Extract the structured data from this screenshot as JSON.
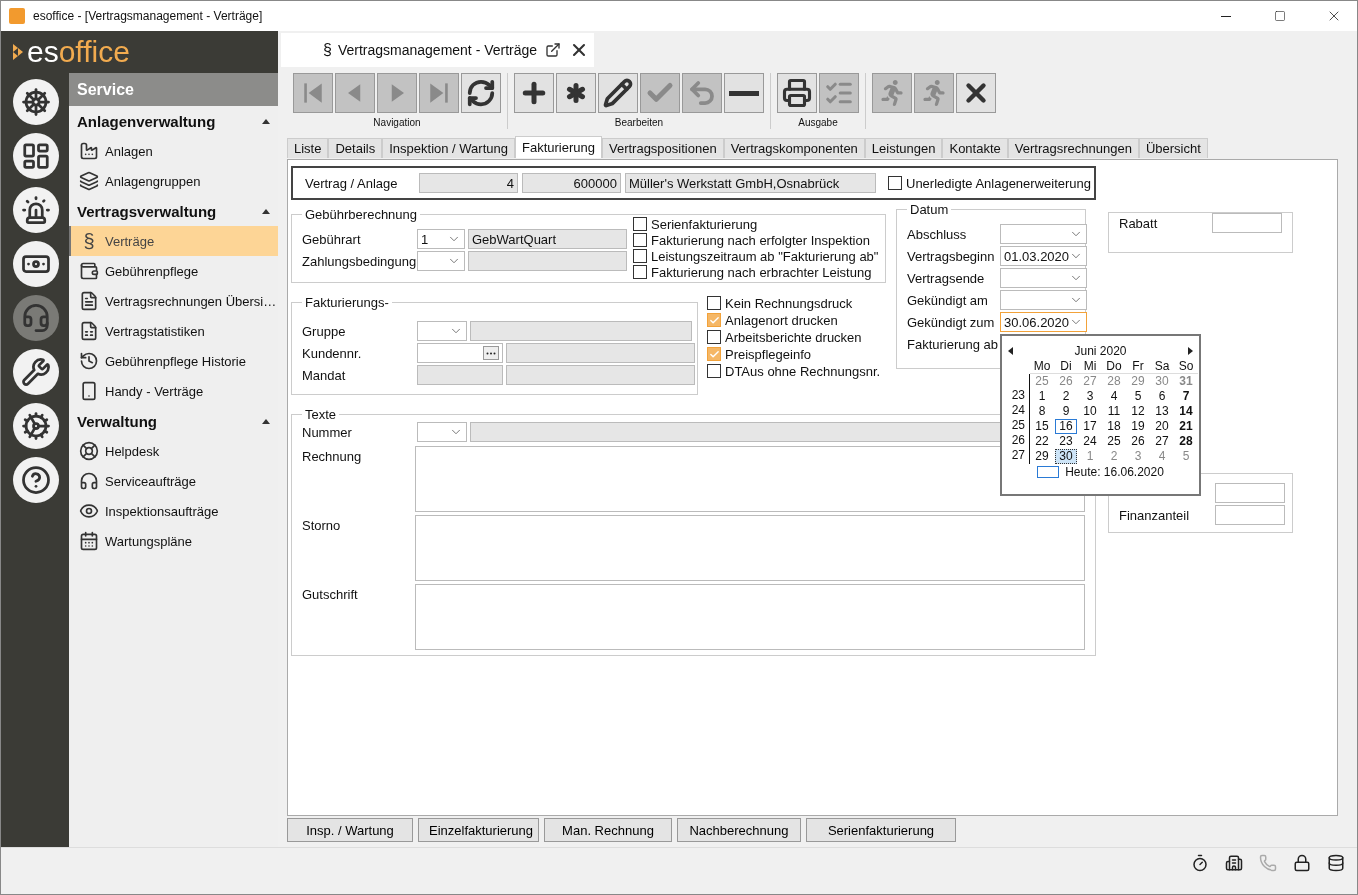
{
  "window": {
    "title": "esoffice - [Vertragsmanagement - Verträge]"
  },
  "logo": {
    "text_start": "es",
    "text_end": "office"
  },
  "modules": [
    {
      "kind": "helm",
      "selected": false
    },
    {
      "kind": "plan",
      "selected": false
    },
    {
      "kind": "alarm",
      "selected": false
    },
    {
      "kind": "money",
      "selected": false
    },
    {
      "kind": "headset",
      "selected": true
    },
    {
      "kind": "tools",
      "selected": false
    },
    {
      "kind": "gears",
      "selected": false
    },
    {
      "kind": "help",
      "selected": false
    }
  ],
  "nav": {
    "title": "Service",
    "sections": [
      {
        "title": "Anlagenverwaltung",
        "expanded": true,
        "items": [
          {
            "label": "Anlagen",
            "selected": false
          },
          {
            "label": "Anlagengruppen",
            "selected": false
          }
        ]
      },
      {
        "title": "Vertragsverwaltung",
        "expanded": true,
        "items": [
          {
            "label": "Verträge",
            "glyph": "§",
            "selected": true
          },
          {
            "label": "Gebührenpflege",
            "selected": false
          },
          {
            "label": "Vertragsrechnungen Übersi…",
            "selected": false
          },
          {
            "label": "Vertragstatistiken",
            "selected": false
          },
          {
            "label": "Gebührenpflege Historie",
            "selected": false
          },
          {
            "label": "Handy - Verträge",
            "selected": false
          }
        ]
      },
      {
        "title": "Verwaltung",
        "expanded": true,
        "items": [
          {
            "label": "Helpdesk",
            "selected": false
          },
          {
            "label": "Serviceaufträge",
            "selected": false
          },
          {
            "label": "Inspektionsaufträge",
            "selected": false
          },
          {
            "label": "Wartungspläne",
            "selected": false
          }
        ]
      }
    ]
  },
  "document_tab": {
    "glyph": "§",
    "title": "Vertragsmanagement - Verträge"
  },
  "toolbar": [
    {
      "label": "Navigation",
      "buttons": [
        {
          "kind": "first",
          "disabled": true
        },
        {
          "kind": "prev",
          "disabled": true
        },
        {
          "kind": "next",
          "disabled": true
        },
        {
          "kind": "last",
          "disabled": true
        },
        {
          "kind": "refresh",
          "disabled": false
        }
      ]
    },
    {
      "label": "Bearbeiten",
      "buttons": [
        {
          "kind": "plus",
          "disabled": false
        },
        {
          "kind": "asterisk",
          "disabled": false
        },
        {
          "kind": "pencil",
          "disabled": false
        },
        {
          "kind": "check",
          "disabled": true
        },
        {
          "kind": "undo",
          "disabled": true
        },
        {
          "kind": "minus",
          "disabled": false
        }
      ]
    },
    {
      "label": "Ausgabe",
      "buttons": [
        {
          "kind": "print",
          "disabled": false
        },
        {
          "kind": "export",
          "disabled": true
        }
      ]
    },
    {
      "buttons": [
        {
          "kind": "run",
          "disabled": true
        },
        {
          "kind": "run",
          "disabled": true
        },
        {
          "kind": "close",
          "disabled": false
        }
      ]
    }
  ],
  "tabs": [
    {
      "label": "Liste",
      "selected": false
    },
    {
      "label": "Details",
      "selected": false
    },
    {
      "label": "Inspektion / Wartung",
      "selected": false
    },
    {
      "label": "Fakturierung",
      "selected": true
    },
    {
      "label": "Vertragspositionen",
      "selected": false
    },
    {
      "label": "Vertragskomponenten",
      "selected": false
    },
    {
      "label": "Leistungen",
      "selected": false
    },
    {
      "label": "Kontakte",
      "selected": false
    },
    {
      "label": "Vertragsrechnungen",
      "selected": false
    },
    {
      "label": "Übersicht",
      "selected": false
    }
  ],
  "contract": {
    "label": "Vertrag / Anlage",
    "number": "4",
    "object": "600000",
    "customer": "Müller's Werkstatt GmbH,Osnabrück",
    "open_extension": {
      "label": "Unerledigte Anlagenerweiterung",
      "checked": false
    }
  },
  "fee": {
    "title": "Gebührberechnung",
    "rows": [
      {
        "label": "Gebührart",
        "code": "1",
        "text": "GebWartQuart"
      },
      {
        "label": "Zahlungsbedingung"
      }
    ],
    "options": [
      {
        "label": "Serienfakturierung",
        "checked": false
      },
      {
        "label": "Fakturierung nach erfolgter Inspektion",
        "checked": false
      },
      {
        "label": "Leistungszeitraum ab \"Fakturierung ab\"",
        "checked": false
      },
      {
        "label": "Fakturierung nach erbrachter Leistung",
        "checked": false
      }
    ]
  },
  "billing": {
    "title": "Fakturierungs-",
    "rows": [
      {
        "label": "Gruppe",
        "kind": "combo"
      },
      {
        "label": "Kundennr.",
        "kind": "lookup"
      },
      {
        "label": "Mandat",
        "kind": "readonly"
      }
    ]
  },
  "print_options": [
    {
      "label": "Kein Rechnungsdruck",
      "checked": false
    },
    {
      "label": "Anlagenort drucken",
      "checked": true
    },
    {
      "label": "Arbeitsberichte drucken",
      "checked": false
    },
    {
      "label": "Preispflegeinfo",
      "checked": true
    },
    {
      "label": "DTAus ohne Rechnungsnr.",
      "checked": false
    }
  ],
  "dates": {
    "title": "Datum",
    "rows": [
      {
        "kind": "date",
        "label": "Abschluss",
        "focused": false
      },
      {
        "kind": "date",
        "label": "Vertragsbeginn",
        "value": "01.03.2020",
        "focused": false
      },
      {
        "kind": "date",
        "label": "Vertragsende",
        "focused": false
      },
      {
        "kind": "date",
        "label": "Gekündigt am",
        "focused": false
      },
      {
        "kind": "date",
        "label": "Gekündigt zum",
        "value": "30.06.2020",
        "focused": true
      },
      {
        "kind": "label",
        "label": "Fakturierung ab"
      }
    ]
  },
  "texts": {
    "title": "Texte",
    "number_label": "Nummer",
    "areas": [
      {
        "label": "Rechnung"
      },
      {
        "label": "Storno"
      },
      {
        "label": "Gutschrift"
      }
    ]
  },
  "discount": {
    "label": "Rabatt"
  },
  "shares": {
    "label": "Finanzanteil"
  },
  "calendar": {
    "month": "Juni 2020",
    "weekdays": [
      "Mo",
      "Di",
      "Mi",
      "Do",
      "Fr",
      "Sa",
      "So"
    ],
    "today_label": "Heute: 16.06.2020",
    "weeks": [
      {
        "days": [
          {
            "day": "25",
            "other_month": true,
            "bold": false,
            "today": false,
            "selected": false
          },
          {
            "day": "26",
            "other_month": true,
            "bold": false,
            "today": false,
            "selected": false
          },
          {
            "day": "27",
            "other_month": true,
            "bold": false,
            "today": false,
            "selected": false
          },
          {
            "day": "28",
            "other_month": true,
            "bold": false,
            "today": false,
            "selected": false
          },
          {
            "day": "29",
            "other_month": true,
            "bold": false,
            "today": false,
            "selected": false
          },
          {
            "day": "30",
            "other_month": true,
            "bold": false,
            "today": false,
            "selected": false
          },
          {
            "day": "31",
            "other_month": true,
            "bold": true,
            "today": false,
            "selected": false
          }
        ]
      },
      {
        "week": "23",
        "days": [
          {
            "day": "1",
            "other_month": false,
            "bold": false,
            "today": false,
            "selected": false
          },
          {
            "day": "2",
            "other_month": false,
            "bold": false,
            "today": false,
            "selected": false
          },
          {
            "day": "3",
            "other_month": false,
            "bold": false,
            "today": false,
            "selected": false
          },
          {
            "day": "4",
            "other_month": false,
            "bold": false,
            "today": false,
            "selected": false
          },
          {
            "day": "5",
            "other_month": false,
            "bold": false,
            "today": false,
            "selected": false
          },
          {
            "day": "6",
            "other_month": false,
            "bold": false,
            "today": false,
            "selected": false
          },
          {
            "day": "7",
            "other_month": false,
            "bold": true,
            "today": false,
            "selected": false
          }
        ]
      },
      {
        "week": "24",
        "days": [
          {
            "day": "8",
            "other_month": false,
            "bold": false,
            "today": false,
            "selected": false
          },
          {
            "day": "9",
            "other_month": false,
            "bold": false,
            "today": false,
            "selected": false
          },
          {
            "day": "10",
            "other_month": false,
            "bold": false,
            "today": false,
            "selected": false
          },
          {
            "day": "11",
            "other_month": false,
            "bold": false,
            "today": false,
            "selected": false
          },
          {
            "day": "12",
            "other_month": false,
            "bold": false,
            "today": false,
            "selected": false
          },
          {
            "day": "13",
            "other_month": false,
            "bold": false,
            "today": false,
            "selected": false
          },
          {
            "day": "14",
            "other_month": false,
            "bold": true,
            "today": false,
            "selected": false
          }
        ]
      },
      {
        "week": "25",
        "days": [
          {
            "day": "15",
            "other_month": false,
            "bold": false,
            "today": false,
            "selected": false
          },
          {
            "day": "16",
            "other_month": false,
            "bold": false,
            "today": true,
            "selected": false
          },
          {
            "day": "17",
            "other_month": false,
            "bold": false,
            "today": false,
            "selected": false
          },
          {
            "day": "18",
            "other_month": false,
            "bold": false,
            "today": false,
            "selected": false
          },
          {
            "day": "19",
            "other_month": false,
            "bold": false,
            "today": false,
            "selected": false
          },
          {
            "day": "20",
            "other_month": false,
            "bold": false,
            "today": false,
            "selected": false
          },
          {
            "day": "21",
            "other_month": false,
            "bold": true,
            "today": false,
            "selected": false
          }
        ]
      },
      {
        "week": "26",
        "days": [
          {
            "day": "22",
            "other_month": false,
            "bold": false,
            "today": false,
            "selected": false
          },
          {
            "day": "23",
            "other_month": false,
            "bold": false,
            "today": false,
            "selected": false
          },
          {
            "day": "24",
            "other_month": false,
            "bold": false,
            "today": false,
            "selected": false
          },
          {
            "day": "25",
            "other_month": false,
            "bold": false,
            "today": false,
            "selected": false
          },
          {
            "day": "26",
            "other_month": false,
            "bold": false,
            "today": false,
            "selected": false
          },
          {
            "day": "27",
            "other_month": false,
            "bold": false,
            "today": false,
            "selected": false
          },
          {
            "day": "28",
            "other_month": false,
            "bold": true,
            "today": false,
            "selected": false
          }
        ]
      },
      {
        "week": "27",
        "days": [
          {
            "day": "29",
            "other_month": false,
            "bold": false,
            "today": false,
            "selected": false
          },
          {
            "day": "30",
            "other_month": false,
            "bold": false,
            "today": false,
            "selected": true
          },
          {
            "day": "1",
            "other_month": true,
            "bold": false,
            "today": false,
            "selected": false
          },
          {
            "day": "2",
            "other_month": true,
            "bold": false,
            "today": false,
            "selected": false
          },
          {
            "day": "3",
            "other_month": true,
            "bold": false,
            "today": false,
            "selected": false
          },
          {
            "day": "4",
            "other_month": true,
            "bold": false,
            "today": false,
            "selected": false
          },
          {
            "day": "5",
            "other_month": true,
            "bold": false,
            "today": false,
            "selected": false
          }
        ]
      }
    ]
  },
  "actions": [
    "Insp. / Wartung",
    "Einzelfakturierung",
    "Man. Rechnung",
    "Nachberechnung",
    "Serienfakturierung"
  ],
  "status_icons": [
    {
      "kind": "timer",
      "disabled": false
    },
    {
      "kind": "building",
      "disabled": false
    },
    {
      "kind": "phone",
      "disabled": true
    },
    {
      "kind": "lock",
      "disabled": false
    },
    {
      "kind": "database",
      "disabled": false
    }
  ]
}
